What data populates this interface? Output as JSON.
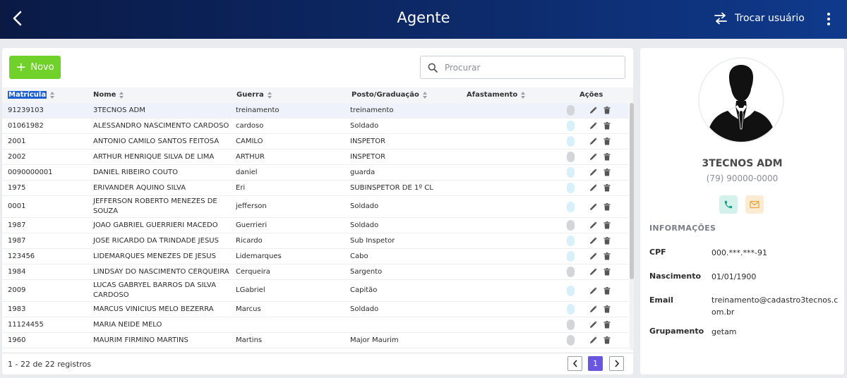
{
  "header": {
    "title": "Agente",
    "switch_user_label": "Trocar usuário",
    "colors": {
      "gradient_start": "#0a1a45",
      "gradient_end": "#0f3a8c"
    }
  },
  "toolbar": {
    "new_button_label": "Novo",
    "search_placeholder": "Procurar",
    "accent_color": "#6fd12a"
  },
  "table": {
    "columns": [
      "Matrícula",
      "Nome",
      "Guerra",
      "Posto/Graduação",
      "Afastamento",
      "Ações"
    ],
    "rows": [
      {
        "matricula": "91239103",
        "nome": "3TECNOS ADM",
        "guerra": "treinamento",
        "posto": "treinamento",
        "afastamento": "",
        "active": false
      },
      {
        "matricula": "01061982",
        "nome": "ALESSANDRO NASCIMENTO CARDOSO",
        "guerra": "cardoso",
        "posto": "Soldado",
        "afastamento": "",
        "active": true
      },
      {
        "matricula": "2001",
        "nome": "ANTONIO CAMILO SANTOS FEITOSA",
        "guerra": "CAMILO",
        "posto": "INSPETOR",
        "afastamento": "",
        "active": true
      },
      {
        "matricula": "2002",
        "nome": "ARTHUR HENRIQUE SILVA DE LIMA",
        "guerra": "ARTHUR",
        "posto": "INSPETOR",
        "afastamento": "",
        "active": false
      },
      {
        "matricula": "0090000001",
        "nome": "DANIEL RIBEIRO COUTO",
        "guerra": "daniel",
        "posto": "guarda",
        "afastamento": "",
        "active": true
      },
      {
        "matricula": "1975",
        "nome": "ERIVANDER AQUINO SILVA",
        "guerra": "Eri",
        "posto": "SUBINSPETOR DE 1º CL",
        "afastamento": "",
        "active": true
      },
      {
        "matricula": "0001",
        "nome": "JEFFERSON ROBERTO MENEZES DE SOUZA",
        "guerra": "jefferson",
        "posto": "Soldado",
        "afastamento": "",
        "active": true
      },
      {
        "matricula": "1987",
        "nome": "JOAO GABRIEL GUERRIERI MACEDO",
        "guerra": "Guerrieri",
        "posto": "Soldado",
        "afastamento": "",
        "active": false
      },
      {
        "matricula": "1987",
        "nome": "JOSE RICARDO DA TRINDADE JESUS",
        "guerra": "Ricardo",
        "posto": "Sub Inspetor",
        "afastamento": "",
        "active": true
      },
      {
        "matricula": "123456",
        "nome": "LIDEMARQUES MENEZES DE JESUS",
        "guerra": "Lidemarques",
        "posto": "Cabo",
        "afastamento": "",
        "active": true
      },
      {
        "matricula": "1984",
        "nome": "LINDSAY DO NASCIMENTO CERQUEIRA",
        "guerra": "Cerqueira",
        "posto": "Sargento",
        "afastamento": "",
        "active": false
      },
      {
        "matricula": "2009",
        "nome": "LUCAS GABRYEL BARROS DA SILVA CARDOSO",
        "guerra": "LGabriel",
        "posto": "Capitão",
        "afastamento": "",
        "active": true
      },
      {
        "matricula": "1983",
        "nome": "MARCUS VINICIUS MELO BEZERRA",
        "guerra": "Marcus",
        "posto": "Soldado",
        "afastamento": "",
        "active": true
      },
      {
        "matricula": "11124455",
        "nome": "MARIA NEIDE MELO",
        "guerra": "",
        "posto": "",
        "afastamento": "",
        "active": false
      },
      {
        "matricula": "1960",
        "nome": "MAURIM FIRMINO MARTINS",
        "guerra": "Martins",
        "posto": "Major Maurim",
        "afastamento": "",
        "active": false
      }
    ]
  },
  "pagination": {
    "summary": "1 - 22 de 22 registros",
    "current_page": "1"
  },
  "profile": {
    "name": "3TECNOS ADM",
    "phone": "(79) 90000-0000",
    "section_title": "INFORMAÇÕES",
    "fields": [
      {
        "label": "CPF",
        "value": "000.***.***-91"
      },
      {
        "label": "Nascimento",
        "value": "01/01/1900"
      },
      {
        "label": "Email",
        "value": "treinamento@cadastro3tecnos.com.br"
      },
      {
        "label": "Grupamento",
        "value": "getam"
      }
    ]
  }
}
